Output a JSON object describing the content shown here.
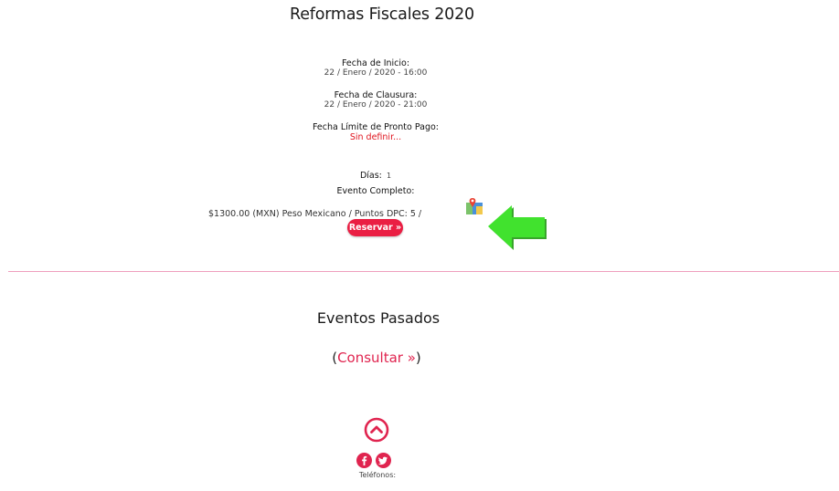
{
  "event": {
    "title": "Reformas Fiscales 2020",
    "start_label": "Fecha de Inicio:",
    "start_value": "22 / Enero / 2020 - 16:00",
    "end_label": "Fecha de Clausura:",
    "end_value": "22 / Enero / 2020 - 21:00",
    "deadline_label": "Fecha Límite de Pronto Pago:",
    "deadline_value": "Sin definir...",
    "days_label": "Días:",
    "days_value": "1",
    "full_event_label": "Evento Completo:",
    "price_text": "$1300.00 (MXN) Peso Mexicano / Puntos DPC: 5 /",
    "reserve_button": "Reservar »"
  },
  "past_events": {
    "heading": "Eventos Pasados",
    "open_paren": "(",
    "consult_link": "Consultar »",
    "close_paren": ")"
  },
  "footer": {
    "phones_label": "Teléfonos:"
  },
  "icons": {
    "map": "map-icon",
    "annotation_arrow": "green-left-arrow",
    "scroll_up": "chevron-up-circle-icon",
    "facebook": "facebook-icon",
    "twitter": "twitter-icon"
  },
  "colors": {
    "accent": "#e0244f",
    "reserve_button": "#ea1e43",
    "deadline_red": "#e0141e",
    "divider": "#ef9fbd",
    "arrow_green": "#3fd62b"
  }
}
